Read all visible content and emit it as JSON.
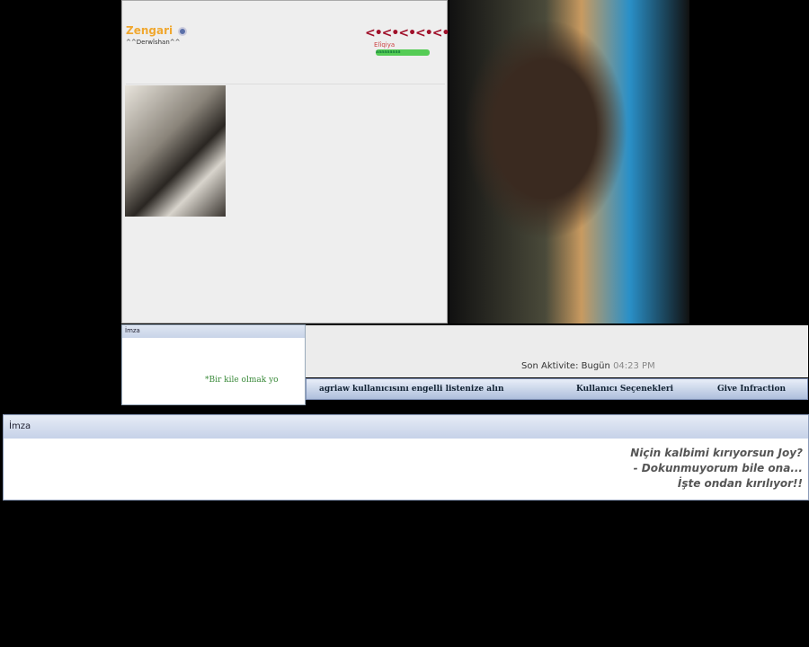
{
  "profile": {
    "username": "Zengari",
    "user_title": "^^Derwîshan^^",
    "rank_icons": "<•<•<•<•<•",
    "rank_label": "Elîqiya",
    "rank_bar": "aaaaaaaaa"
  },
  "signature_small": {
    "header": "İmza",
    "text": "*Bir kile olmak yo"
  },
  "activity": {
    "label": "Son Aktivite:",
    "day": "Bugün",
    "time": "04:23 PM"
  },
  "actions": {
    "ignore": "agriaw kullanıcısını engelli listenize alın",
    "user_options": "Kullanıcı Seçenekleri",
    "infraction": "Give Infraction"
  },
  "signature": {
    "header": "İmza",
    "lines": [
      "Niçin kalbimi kırıyorsun Joy?",
      "- Dokunmuyorum bile ona...",
      "İşte ondan kırılıyor!!"
    ]
  }
}
